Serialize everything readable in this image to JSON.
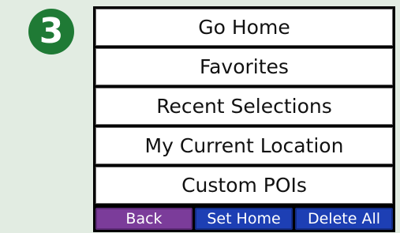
{
  "step": {
    "number": "3",
    "color": "#1f7a35"
  },
  "menu": {
    "items": [
      {
        "label": "Go Home"
      },
      {
        "label": "Favorites"
      },
      {
        "label": "Recent Selections"
      },
      {
        "label": "My Current Location"
      },
      {
        "label": "Custom POIs"
      }
    ]
  },
  "bottom_bar": {
    "back_label": "Back",
    "set_home_label": "Set Home",
    "delete_all_label": "Delete All",
    "back_color": "#7b3c9a",
    "action_color": "#1d3fb4"
  },
  "colors": {
    "background": "#e2ece2",
    "menu_item_background": "#ffffff",
    "device_frame": "#000000"
  }
}
